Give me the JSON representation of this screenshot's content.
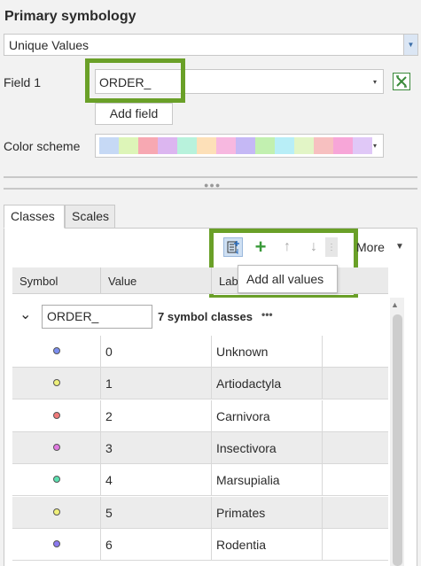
{
  "panel_title": "Primary symbology",
  "method": {
    "value": "Unique Values",
    "caret": "▼"
  },
  "field1": {
    "label": "Field 1",
    "value": "ORDER_",
    "caret": "▾"
  },
  "expression_icon": "expression-icon",
  "add_field_label": "Add field",
  "color_scheme": {
    "label": "Color scheme",
    "caret": "▾",
    "swatches": [
      "#c6d9f5",
      "#ddf5b8",
      "#f7a8b2",
      "#dcb6f0",
      "#b8f2dc",
      "#fde0b8",
      "#f7b8e0",
      "#c5b8f5",
      "#c2f0b0",
      "#b8eef7",
      "#e2f5c6",
      "#f7c0c0",
      "#f7a6d8",
      "#e0c8f7"
    ]
  },
  "tabs": [
    {
      "label": "Classes",
      "active": true
    },
    {
      "label": "Scales",
      "active": false
    }
  ],
  "toolbar": {
    "icons": [
      "add-all-values-icon",
      "add-icon",
      "move-up-icon",
      "move-down-icon",
      "more-options-icon"
    ],
    "more_label": "More",
    "more_caret": "▼",
    "tooltip": "Add all values"
  },
  "grid": {
    "headers": {
      "symbol": "Symbol",
      "value": "Value",
      "label": "Lab"
    },
    "group": {
      "caret": "⌄",
      "field": "ORDER_",
      "count_label": "7 symbol classes",
      "menu": "•••"
    },
    "rows": [
      {
        "value": "0",
        "label": "Unknown",
        "color": "#7b8ef0"
      },
      {
        "value": "1",
        "label": "Artiodactyla",
        "color": "#eef07a"
      },
      {
        "value": "2",
        "label": "Carnivora",
        "color": "#f07a7a"
      },
      {
        "value": "3",
        "label": "Insectivora",
        "color": "#e07ae0"
      },
      {
        "value": "4",
        "label": "Marsupialia",
        "color": "#5ce0b0"
      },
      {
        "value": "5",
        "label": "Primates",
        "color": "#f0f07a"
      },
      {
        "value": "6",
        "label": "Rodentia",
        "color": "#8c7af0"
      }
    ]
  },
  "highlight_color": "#6aa028"
}
